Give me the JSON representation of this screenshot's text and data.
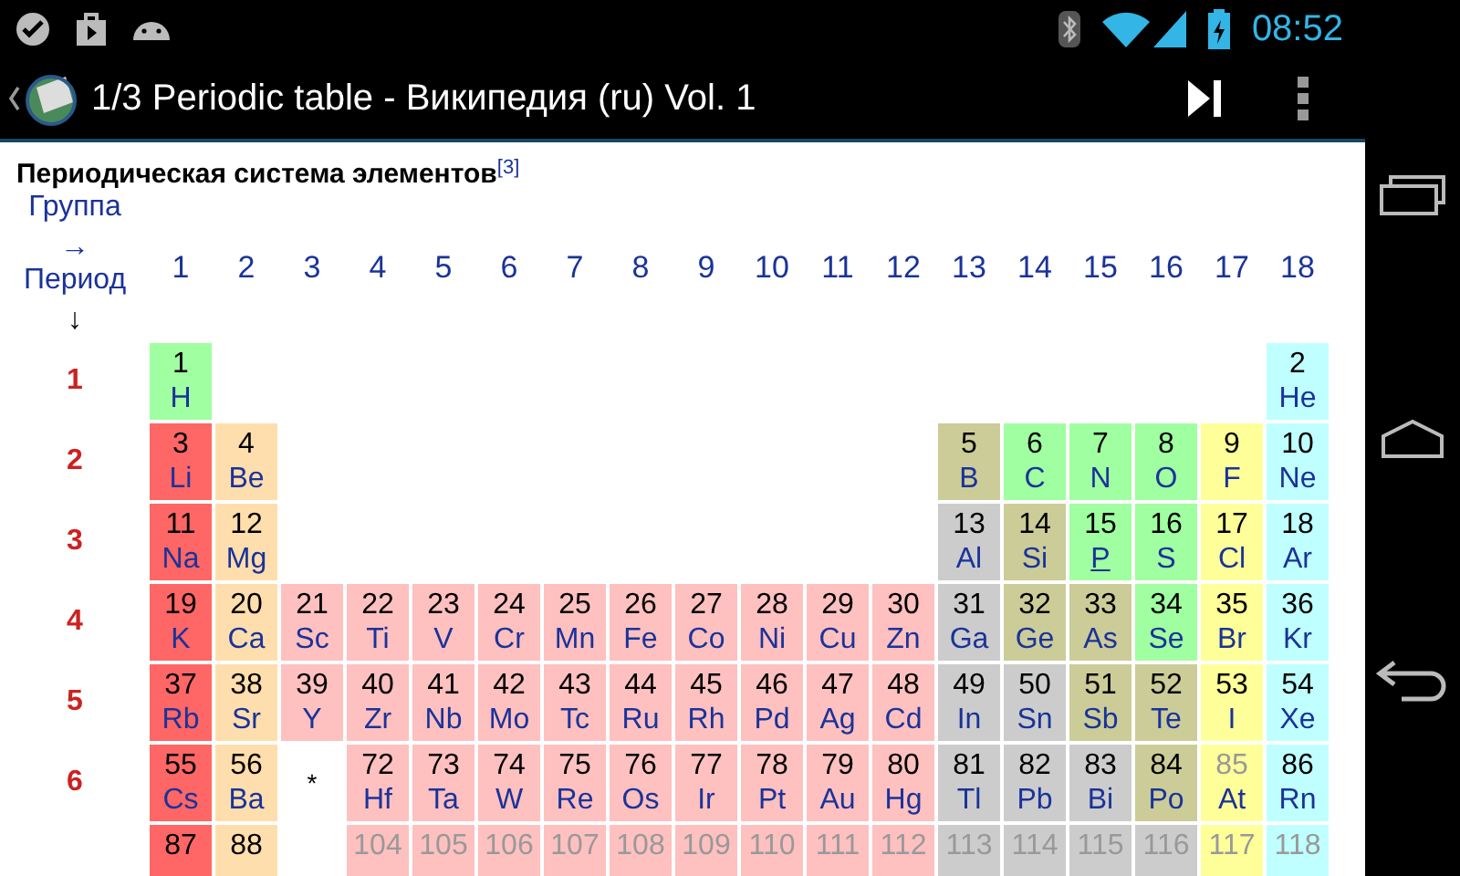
{
  "status_bar": {
    "time": "08:52"
  },
  "action_bar": {
    "title": "1/3 Periodic table - Википедия (ru) Vol. 1"
  },
  "article": {
    "heading": "Периодическая система элементов$^{[3]}$"
  },
  "table": {
    "group_label": "Группа",
    "group_arrow": "→",
    "period_label": "Период",
    "period_arrow": "↓",
    "groups": [
      "1",
      "2",
      "3",
      "4",
      "5",
      "6",
      "7",
      "8",
      "9",
      "10",
      "11",
      "12",
      "13",
      "14",
      "15",
      "16",
      "17",
      "18"
    ],
    "periods": [
      {
        "label": "1",
        "cells": [
          {
            "kind": "nonmetal",
            "number": "1",
            "symbol": "H",
            "unknown": false,
            "underlined": false
          },
          {
            "kind": "empty"
          },
          {
            "kind": "empty"
          },
          {
            "kind": "empty"
          },
          {
            "kind": "empty"
          },
          {
            "kind": "empty"
          },
          {
            "kind": "empty"
          },
          {
            "kind": "empty"
          },
          {
            "kind": "empty"
          },
          {
            "kind": "empty"
          },
          {
            "kind": "empty"
          },
          {
            "kind": "empty"
          },
          {
            "kind": "empty"
          },
          {
            "kind": "empty"
          },
          {
            "kind": "empty"
          },
          {
            "kind": "empty"
          },
          {
            "kind": "empty"
          },
          {
            "kind": "noble",
            "number": "2",
            "symbol": "He",
            "unknown": false,
            "underlined": false
          }
        ]
      },
      {
        "label": "2",
        "cells": [
          {
            "kind": "alkali",
            "number": "3",
            "symbol": "Li",
            "unknown": false,
            "underlined": false
          },
          {
            "kind": "alkaline",
            "number": "4",
            "symbol": "Be",
            "unknown": false,
            "underlined": false
          },
          {
            "kind": "empty"
          },
          {
            "kind": "empty"
          },
          {
            "kind": "empty"
          },
          {
            "kind": "empty"
          },
          {
            "kind": "empty"
          },
          {
            "kind": "empty"
          },
          {
            "kind": "empty"
          },
          {
            "kind": "empty"
          },
          {
            "kind": "empty"
          },
          {
            "kind": "empty"
          },
          {
            "kind": "metalloid",
            "number": "5",
            "symbol": "B",
            "unknown": false,
            "underlined": false
          },
          {
            "kind": "nonmetal",
            "number": "6",
            "symbol": "C",
            "unknown": false,
            "underlined": false
          },
          {
            "kind": "nonmetal",
            "number": "7",
            "symbol": "N",
            "unknown": false,
            "underlined": false
          },
          {
            "kind": "nonmetal",
            "number": "8",
            "symbol": "O",
            "unknown": false,
            "underlined": false
          },
          {
            "kind": "halogen",
            "number": "9",
            "symbol": "F",
            "unknown": false,
            "underlined": false
          },
          {
            "kind": "noble",
            "number": "10",
            "symbol": "Ne",
            "unknown": false,
            "underlined": false
          }
        ]
      },
      {
        "label": "3",
        "cells": [
          {
            "kind": "alkali",
            "number": "11",
            "symbol": "Na",
            "unknown": false,
            "underlined": false
          },
          {
            "kind": "alkaline",
            "number": "12",
            "symbol": "Mg",
            "unknown": false,
            "underlined": false
          },
          {
            "kind": "empty"
          },
          {
            "kind": "empty"
          },
          {
            "kind": "empty"
          },
          {
            "kind": "empty"
          },
          {
            "kind": "empty"
          },
          {
            "kind": "empty"
          },
          {
            "kind": "empty"
          },
          {
            "kind": "empty"
          },
          {
            "kind": "empty"
          },
          {
            "kind": "empty"
          },
          {
            "kind": "poor",
            "number": "13",
            "symbol": "Al",
            "unknown": false,
            "underlined": false
          },
          {
            "kind": "metalloid",
            "number": "14",
            "symbol": "Si",
            "unknown": false,
            "underlined": false
          },
          {
            "kind": "nonmetal",
            "number": "15",
            "symbol": "P",
            "unknown": false,
            "underlined": true
          },
          {
            "kind": "nonmetal",
            "number": "16",
            "symbol": "S",
            "unknown": false,
            "underlined": false
          },
          {
            "kind": "halogen",
            "number": "17",
            "symbol": "Cl",
            "unknown": false,
            "underlined": false
          },
          {
            "kind": "noble",
            "number": "18",
            "symbol": "Ar",
            "unknown": false,
            "underlined": false
          }
        ]
      },
      {
        "label": "4",
        "cells": [
          {
            "kind": "alkali",
            "number": "19",
            "symbol": "K",
            "unknown": false,
            "underlined": false
          },
          {
            "kind": "alkaline",
            "number": "20",
            "symbol": "Ca",
            "unknown": false,
            "underlined": false
          },
          {
            "kind": "transition",
            "number": "21",
            "symbol": "Sc",
            "unknown": false,
            "underlined": false
          },
          {
            "kind": "transition",
            "number": "22",
            "symbol": "Ti",
            "unknown": false,
            "underlined": false
          },
          {
            "kind": "transition",
            "number": "23",
            "symbol": "V",
            "unknown": false,
            "underlined": false
          },
          {
            "kind": "transition",
            "number": "24",
            "symbol": "Cr",
            "unknown": false,
            "underlined": false
          },
          {
            "kind": "transition",
            "number": "25",
            "symbol": "Mn",
            "unknown": false,
            "underlined": false
          },
          {
            "kind": "transition",
            "number": "26",
            "symbol": "Fe",
            "unknown": false,
            "underlined": false
          },
          {
            "kind": "transition",
            "number": "27",
            "symbol": "Co",
            "unknown": false,
            "underlined": false
          },
          {
            "kind": "transition",
            "number": "28",
            "symbol": "Ni",
            "unknown": false,
            "underlined": false
          },
          {
            "kind": "transition",
            "number": "29",
            "symbol": "Cu",
            "unknown": false,
            "underlined": false
          },
          {
            "kind": "transition",
            "number": "30",
            "symbol": "Zn",
            "unknown": false,
            "underlined": false
          },
          {
            "kind": "poor",
            "number": "31",
            "symbol": "Ga",
            "unknown": false,
            "underlined": false
          },
          {
            "kind": "metalloid",
            "number": "32",
            "symbol": "Ge",
            "unknown": false,
            "underlined": false
          },
          {
            "kind": "metalloid",
            "number": "33",
            "symbol": "As",
            "unknown": false,
            "underlined": false
          },
          {
            "kind": "nonmetal",
            "number": "34",
            "symbol": "Se",
            "unknown": false,
            "underlined": false
          },
          {
            "kind": "halogen",
            "number": "35",
            "symbol": "Br",
            "unknown": false,
            "underlined": false
          },
          {
            "kind": "noble",
            "number": "36",
            "symbol": "Kr",
            "unknown": false,
            "underlined": false
          }
        ]
      },
      {
        "label": "5",
        "cells": [
          {
            "kind": "alkali",
            "number": "37",
            "symbol": "Rb",
            "unknown": false,
            "underlined": false
          },
          {
            "kind": "alkaline",
            "number": "38",
            "symbol": "Sr",
            "unknown": false,
            "underlined": false
          },
          {
            "kind": "transition",
            "number": "39",
            "symbol": "Y",
            "unknown": false,
            "underlined": false
          },
          {
            "kind": "transition",
            "number": "40",
            "symbol": "Zr",
            "unknown": false,
            "underlined": false
          },
          {
            "kind": "transition",
            "number": "41",
            "symbol": "Nb",
            "unknown": false,
            "underlined": false
          },
          {
            "kind": "transition",
            "number": "42",
            "symbol": "Mo",
            "unknown": false,
            "underlined": false
          },
          {
            "kind": "transition",
            "number": "43",
            "symbol": "Tc",
            "unknown": false,
            "underlined": false
          },
          {
            "kind": "transition",
            "number": "44",
            "symbol": "Ru",
            "unknown": false,
            "underlined": false
          },
          {
            "kind": "transition",
            "number": "45",
            "symbol": "Rh",
            "unknown": false,
            "underlined": false
          },
          {
            "kind": "transition",
            "number": "46",
            "symbol": "Pd",
            "unknown": false,
            "underlined": false
          },
          {
            "kind": "transition",
            "number": "47",
            "symbol": "Ag",
            "unknown": false,
            "underlined": false
          },
          {
            "kind": "transition",
            "number": "48",
            "symbol": "Cd",
            "unknown": false,
            "underlined": false
          },
          {
            "kind": "poor",
            "number": "49",
            "symbol": "In",
            "unknown": false,
            "underlined": false
          },
          {
            "kind": "poor",
            "number": "50",
            "symbol": "Sn",
            "unknown": false,
            "underlined": false
          },
          {
            "kind": "metalloid",
            "number": "51",
            "symbol": "Sb",
            "unknown": false,
            "underlined": false
          },
          {
            "kind": "metalloid",
            "number": "52",
            "symbol": "Te",
            "unknown": false,
            "underlined": false
          },
          {
            "kind": "halogen",
            "number": "53",
            "symbol": "I",
            "unknown": false,
            "underlined": false
          },
          {
            "kind": "noble",
            "number": "54",
            "symbol": "Xe",
            "unknown": false,
            "underlined": false
          }
        ]
      },
      {
        "label": "6",
        "cells": [
          {
            "kind": "alkali",
            "number": "55",
            "symbol": "Cs",
            "unknown": false,
            "underlined": false
          },
          {
            "kind": "alkaline",
            "number": "56",
            "symbol": "Ba",
            "unknown": false,
            "underlined": false
          },
          {
            "kind": "marker",
            "text": "*"
          },
          {
            "kind": "transition",
            "number": "72",
            "symbol": "Hf",
            "unknown": false,
            "underlined": false
          },
          {
            "kind": "transition",
            "number": "73",
            "symbol": "Ta",
            "unknown": false,
            "underlined": false
          },
          {
            "kind": "transition",
            "number": "74",
            "symbol": "W",
            "unknown": false,
            "underlined": false
          },
          {
            "kind": "transition",
            "number": "75",
            "symbol": "Re",
            "unknown": false,
            "underlined": false
          },
          {
            "kind": "transition",
            "number": "76",
            "symbol": "Os",
            "unknown": false,
            "underlined": false
          },
          {
            "kind": "transition",
            "number": "77",
            "symbol": "Ir",
            "unknown": false,
            "underlined": false
          },
          {
            "kind": "transition",
            "number": "78",
            "symbol": "Pt",
            "unknown": false,
            "underlined": false
          },
          {
            "kind": "transition",
            "number": "79",
            "symbol": "Au",
            "unknown": false,
            "underlined": false
          },
          {
            "kind": "transition",
            "number": "80",
            "symbol": "Hg",
            "unknown": false,
            "underlined": false
          },
          {
            "kind": "poor",
            "number": "81",
            "symbol": "Tl",
            "unknown": false,
            "underlined": false
          },
          {
            "kind": "poor",
            "number": "82",
            "symbol": "Pb",
            "unknown": false,
            "underlined": false
          },
          {
            "kind": "poor",
            "number": "83",
            "symbol": "Bi",
            "unknown": false,
            "underlined": false
          },
          {
            "kind": "metalloid",
            "number": "84",
            "symbol": "Po",
            "unknown": false,
            "underlined": false
          },
          {
            "kind": "halogen",
            "number": "85",
            "symbol": "At",
            "unknown": true,
            "underlined": false
          },
          {
            "kind": "noble",
            "number": "86",
            "symbol": "Rn",
            "unknown": false,
            "underlined": false
          }
        ]
      },
      {
        "cells": [
          {
            "kind": "alkali",
            "number": "87",
            "unknown": false,
            "underlined": false
          },
          {
            "kind": "alkaline",
            "number": "88",
            "unknown": false,
            "underlined": false
          },
          {
            "kind": "empty"
          },
          {
            "kind": "transition",
            "number": "104",
            "unknown": true,
            "underlined": false
          },
          {
            "kind": "transition",
            "number": "105",
            "unknown": true,
            "underlined": false
          },
          {
            "kind": "transition",
            "number": "106",
            "unknown": true,
            "underlined": false
          },
          {
            "kind": "transition",
            "number": "107",
            "unknown": true,
            "underlined": false
          },
          {
            "kind": "transition",
            "number": "108",
            "unknown": true,
            "underlined": false
          },
          {
            "kind": "transition",
            "number": "109",
            "unknown": true,
            "underlined": false
          },
          {
            "kind": "transition",
            "number": "110",
            "unknown": true,
            "underlined": false
          },
          {
            "kind": "transition",
            "number": "111",
            "unknown": true,
            "underlined": false
          },
          {
            "kind": "transition",
            "number": "112",
            "unknown": true,
            "underlined": false
          },
          {
            "kind": "poor",
            "number": "113",
            "unknown": true,
            "underlined": false
          },
          {
            "kind": "poor",
            "number": "114",
            "unknown": true,
            "underlined": false
          },
          {
            "kind": "poor",
            "number": "115",
            "unknown": true,
            "underlined": false
          },
          {
            "kind": "poor",
            "number": "116",
            "unknown": true,
            "underlined": false
          },
          {
            "kind": "halogen",
            "number": "117",
            "unknown": true,
            "underlined": false
          },
          {
            "kind": "noble",
            "number": "118",
            "unknown": true,
            "underlined": false
          }
        ]
      }
    ]
  }
}
